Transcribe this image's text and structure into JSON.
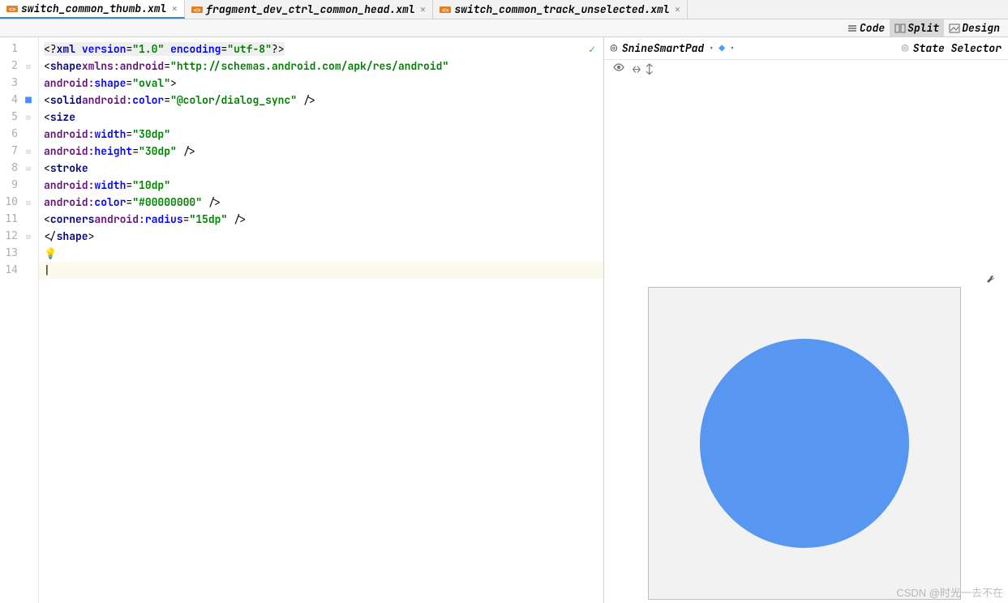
{
  "tabs": [
    {
      "label": "switch_common_thumb.xml",
      "active": true
    },
    {
      "label": "fragment_dev_ctrl_common_head.xml",
      "active": false
    },
    {
      "label": "switch_common_track_unselected.xml",
      "active": false
    }
  ],
  "view_modes": {
    "code": "Code",
    "split": "Split",
    "design": "Design",
    "active": "Split"
  },
  "gutter": {
    "lines": [
      "1",
      "2",
      "3",
      "4",
      "5",
      "6",
      "7",
      "8",
      "9",
      "10",
      "11",
      "12",
      "13",
      "14"
    ],
    "bookmark_line": 4
  },
  "code": {
    "l1": {
      "open": "<?",
      "kw": "xml",
      "a1": "version",
      "v1": "\"1.0\"",
      "a2": "encoding",
      "v2": "\"utf-8\"",
      "close": "?>"
    },
    "l2": {
      "open": "<",
      "tag": "shape",
      "nsattr": "xmlns:android",
      "nsval": "\"http://schemas.android.com/apk/res/android\""
    },
    "l3": {
      "ns": "android:",
      "attr": "shape",
      "val": "\"oval\"",
      "close": ">"
    },
    "l4": {
      "open": "<",
      "tag": "solid",
      "ns": "android:",
      "attr": "color",
      "val": "\"@color/dialog_sync\"",
      "close": " />"
    },
    "l5": {
      "open": "<",
      "tag": "size"
    },
    "l6": {
      "ns": "android:",
      "attr": "width",
      "val": "\"30dp\""
    },
    "l7": {
      "ns": "android:",
      "attr": "height",
      "val": "\"30dp\"",
      "close": " />"
    },
    "l8": {
      "open": "<",
      "tag": "stroke"
    },
    "l9": {
      "ns": "android:",
      "attr": "width",
      "val": "\"10dp\""
    },
    "l10": {
      "ns": "android:",
      "attr": "color",
      "val": "\"#00000000\"",
      "close": " />"
    },
    "l11": {
      "open": "<",
      "tag": "corners",
      "ns": "android:",
      "attr": "radius",
      "val": "\"15dp\"",
      "close": " />"
    },
    "l12": {
      "open": "</",
      "tag": "shape",
      "close": ">"
    },
    "caret_char": "|"
  },
  "preview": {
    "device_label": "SnineSmartPad",
    "state_selector_label": "State Selector",
    "circle_color": "#5797f1"
  },
  "watermark": "CSDN @时光一去不在"
}
